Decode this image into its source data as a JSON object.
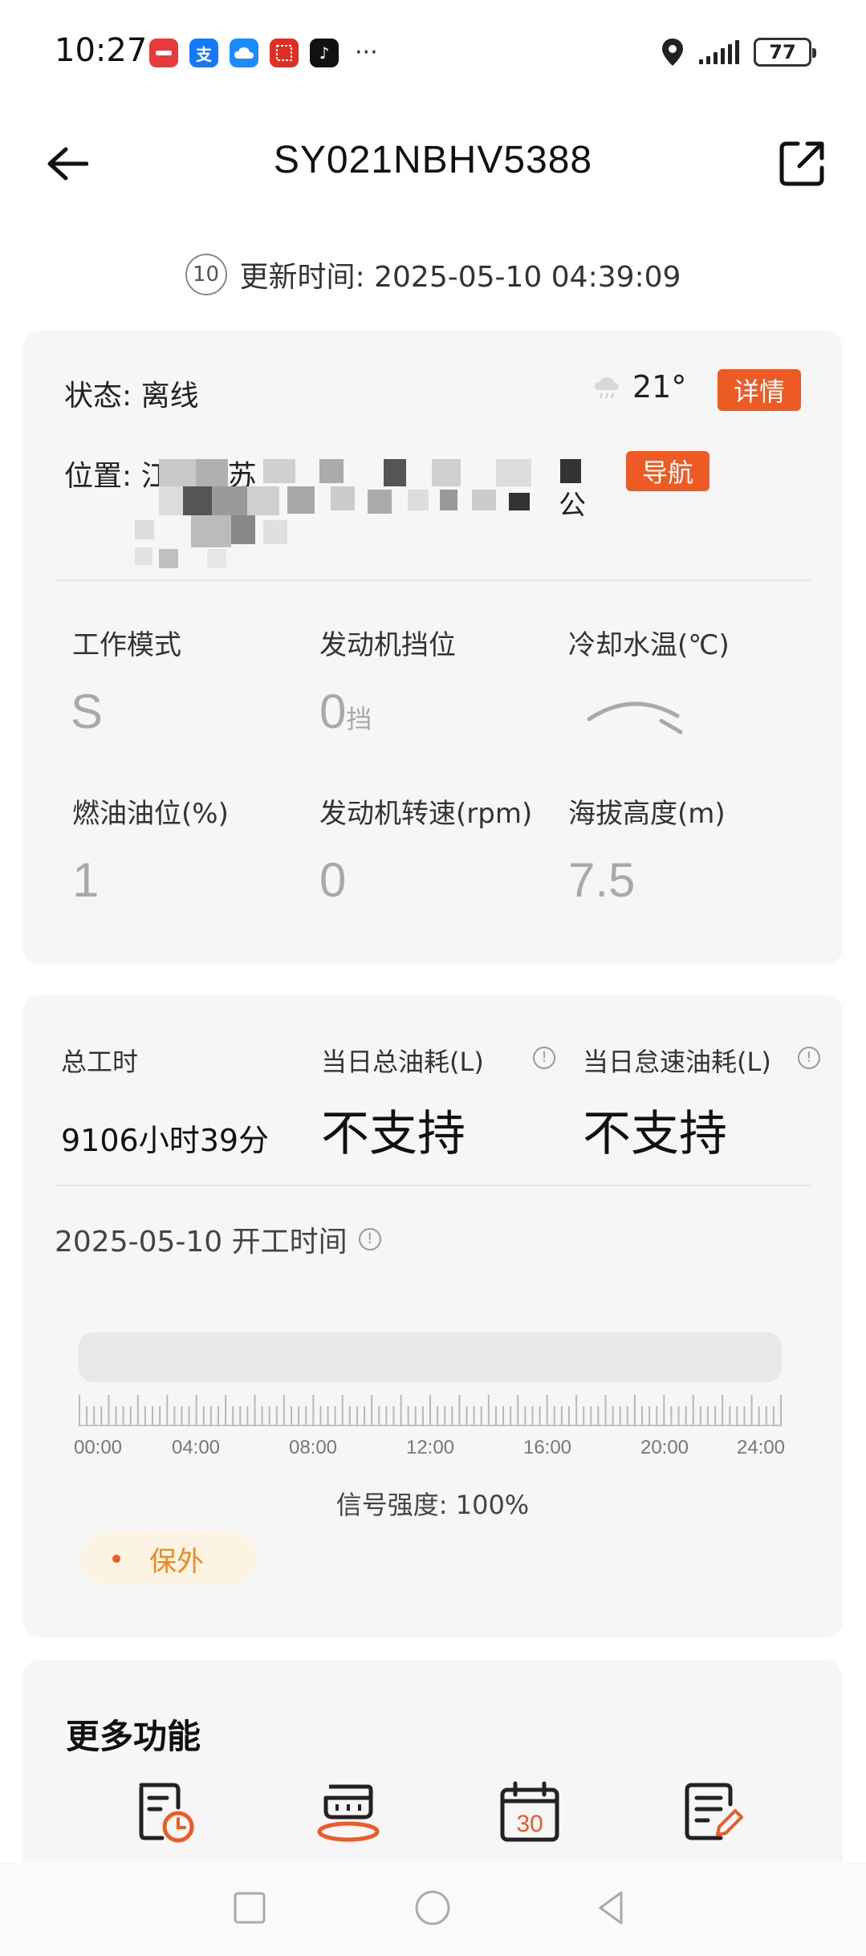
{
  "status_bar": {
    "time": "10:27",
    "more": "···",
    "battery": "77",
    "apps": [
      {
        "name": "huawei-app-icon",
        "color": "#e83a3a",
        "glyph": ""
      },
      {
        "name": "alipay-icon",
        "color": "#1677ff",
        "glyph": "支"
      },
      {
        "name": "cloud-app-icon",
        "color": "#1a8cff",
        "glyph": ""
      },
      {
        "name": "pinduoduo-icon",
        "color": "#e02e24",
        "glyph": ""
      },
      {
        "name": "tiktok-icon",
        "color": "#111111",
        "glyph": "♪"
      }
    ]
  },
  "header": {
    "title": "SY021NBHV5388"
  },
  "update": {
    "countdown": "10",
    "text": "更新时间: 2025-05-10 04:39:09"
  },
  "overview": {
    "status_text": "状态:  离线",
    "temperature": "21°",
    "detail_label": "详情",
    "location_label": "位置:  江苏省苏",
    "location_tail": "公",
    "nav_label": "导航",
    "metrics": [
      {
        "label": "工作模式",
        "value": "S",
        "unit": ""
      },
      {
        "label": "发动机挡位",
        "value": "0",
        "unit": "挡"
      },
      {
        "label": "冷却水温(℃)",
        "value": "",
        "unit": ""
      },
      {
        "label": "燃油油位(%)",
        "value": "1",
        "unit": ""
      },
      {
        "label": "发动机转速(rpm)",
        "value": "0",
        "unit": ""
      },
      {
        "label": "海拔高度(m)",
        "value": "7.5",
        "unit": ""
      }
    ]
  },
  "work": {
    "total_hours_label": "总工时",
    "total_hours_value": "9106小时39分",
    "daily_fuel_label": "当日总油耗(L)",
    "daily_fuel_value": "不支持",
    "idle_fuel_label": "当日怠速油耗(L)",
    "idle_fuel_value": "不支持",
    "info_glyph": "!",
    "day_title": "2025-05-10  开工时间",
    "tick_labels": [
      "00:00",
      "04:00",
      "08:00",
      "12:00",
      "16:00",
      "20:00",
      "24:00"
    ],
    "signal_strength": "信号强度:  100%",
    "warranty": "保外"
  },
  "more": {
    "title": "更多功能",
    "calendar_day": "30"
  },
  "colors": {
    "accent": "#ee5a24",
    "card_bg": "#f6f6f6",
    "value_gray": "#a9a9a9"
  }
}
